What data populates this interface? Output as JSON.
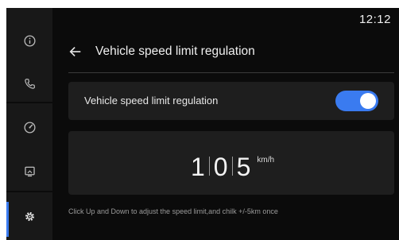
{
  "status": {
    "time": "12:12"
  },
  "sidebar": {
    "items": [
      {
        "icon": "info-icon",
        "active": false
      },
      {
        "icon": "phone-icon",
        "active": false
      },
      {
        "icon": "speedometer-icon",
        "active": false
      },
      {
        "icon": "display-icon",
        "active": false
      },
      {
        "icon": "gear-icon",
        "active": true
      }
    ]
  },
  "header": {
    "title": "Vehicle speed limit regulation"
  },
  "toggle_card": {
    "label": "Vehicle speed limit regulation",
    "enabled": true
  },
  "speed": {
    "digits": [
      "1",
      "0",
      "5"
    ],
    "unit": "km/h"
  },
  "hint": "Click Up and Down to adjust the speed limit,and chilk +/-5km once",
  "colors": {
    "accent": "#3a7bf0",
    "background": "#0b0b0b",
    "card": "#1e1e1e",
    "sidebar": "#181818"
  }
}
